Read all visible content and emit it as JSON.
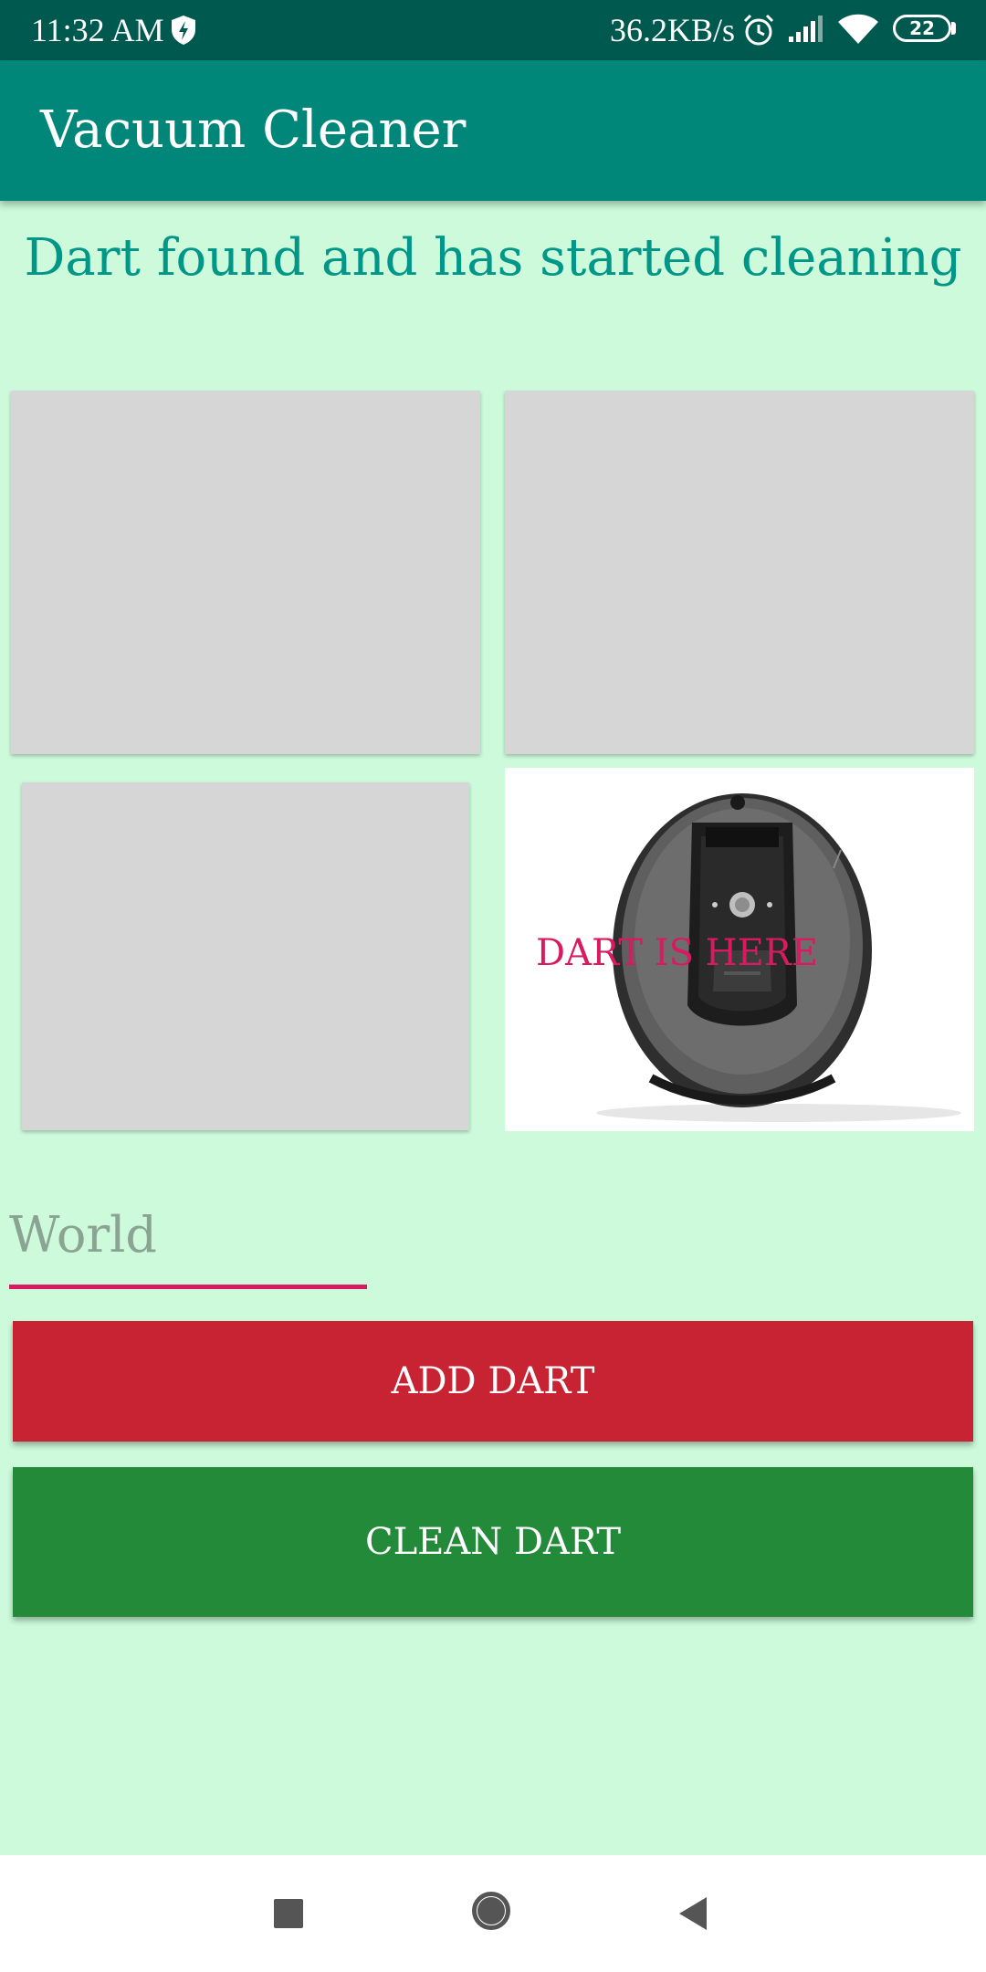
{
  "status_bar": {
    "time": "11:32 AM",
    "network_speed": "36.2KB/s",
    "battery_level": "22",
    "icons": [
      "shield-icon",
      "alarm-icon",
      "signal-icon",
      "wifi-icon",
      "battery-icon"
    ]
  },
  "app_bar": {
    "title": "Vacuum Cleaner",
    "color": "#00877a"
  },
  "main": {
    "status_message": "Dart found and has started cleaning",
    "tiles": [
      {
        "state": "empty"
      },
      {
        "state": "empty"
      },
      {
        "state": "empty"
      },
      {
        "state": "robot",
        "label": "DART IS HERE",
        "image": "robot-vacuum-image"
      }
    ],
    "world_input": {
      "value": "",
      "placeholder": "World"
    },
    "add_button": {
      "label": "ADD DART",
      "color": "#c82333"
    },
    "clean_button": {
      "label": "CLEAN DART",
      "color": "#238a3a"
    }
  },
  "nav_bar": {
    "items": [
      "recents-square-icon",
      "home-circle-icon",
      "back-triangle-icon"
    ]
  }
}
